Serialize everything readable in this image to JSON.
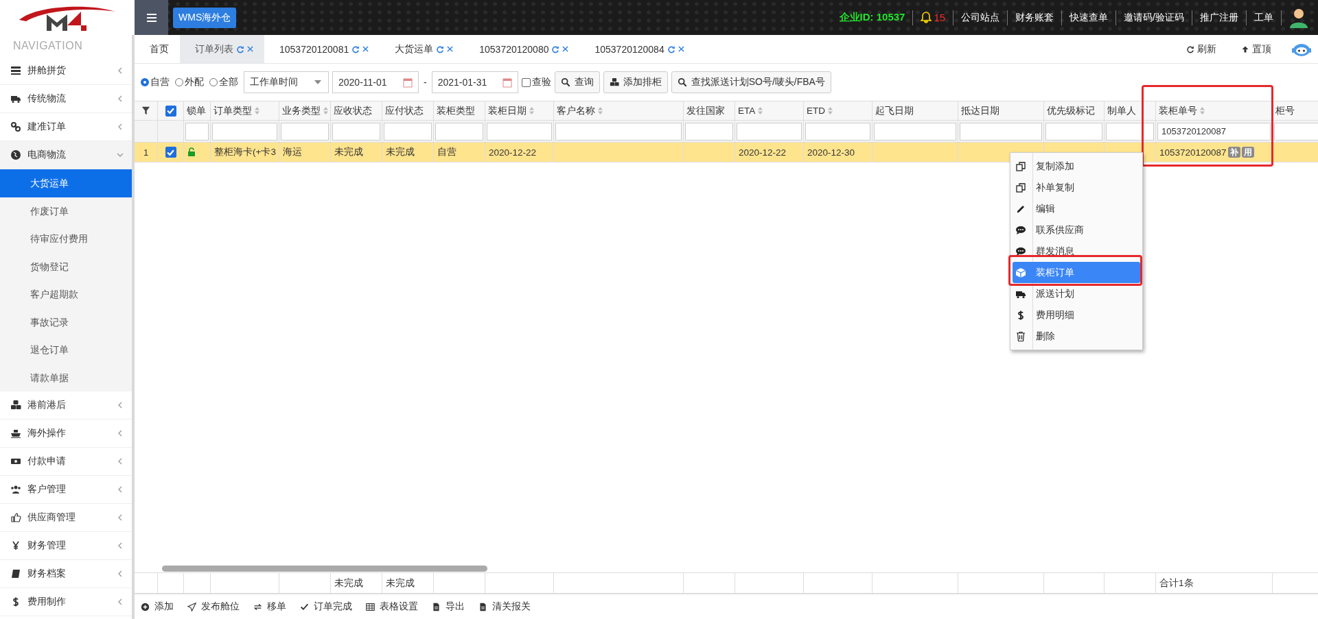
{
  "top_bar": {
    "app_button": "WMS海外仓",
    "company_id": "企业ID: 10537",
    "notifications": "15",
    "links": [
      "公司站点",
      "财务账套",
      "快速查单",
      "邀请码/验证码",
      "推广注册",
      "工单"
    ]
  },
  "sidebar": {
    "title": "NAVIGATION",
    "items": [
      {
        "label": "拼舱拼货",
        "expanded": false
      },
      {
        "label": "传统物流",
        "expanded": false
      },
      {
        "label": "建准订单",
        "expanded": false
      },
      {
        "label": "电商物流",
        "expanded": true,
        "children": [
          {
            "label": "大货运单",
            "selected": true
          },
          {
            "label": "作废订单",
            "selected": false
          },
          {
            "label": "待审应付费用",
            "selected": false
          },
          {
            "label": "货物登记",
            "selected": false
          },
          {
            "label": "客户超期款",
            "selected": false
          },
          {
            "label": "事故记录",
            "selected": false
          },
          {
            "label": "退仓订单",
            "selected": false
          },
          {
            "label": "请款单据",
            "selected": false
          }
        ]
      },
      {
        "label": "港前港后",
        "expanded": false
      },
      {
        "label": "海外操作",
        "expanded": false
      },
      {
        "label": "付款申请",
        "expanded": false
      },
      {
        "label": "客户管理",
        "expanded": false
      },
      {
        "label": "供应商管理",
        "expanded": false
      },
      {
        "label": "财务管理",
        "expanded": false
      },
      {
        "label": "财务档案",
        "expanded": false
      },
      {
        "label": "费用制作",
        "expanded": false
      }
    ]
  },
  "tabs": [
    {
      "label": "首页",
      "selected": false,
      "closable": false
    },
    {
      "label": "订单列表",
      "selected": true,
      "closable": true
    },
    {
      "label": "1053720120081",
      "selected": false,
      "closable": true
    },
    {
      "label": "大货运单",
      "selected": false,
      "closable": true
    },
    {
      "label": "1053720120080",
      "selected": false,
      "closable": true
    },
    {
      "label": "1053720120084",
      "selected": false,
      "closable": true
    }
  ],
  "tab_actions": [
    "刷新",
    "置顶"
  ],
  "filters": {
    "radios": [
      {
        "label": "自营",
        "selected": true
      },
      {
        "label": "外配",
        "selected": false
      },
      {
        "label": "全部",
        "selected": false
      }
    ],
    "date_type": "工作单时间",
    "date_from": "2020-11-01",
    "separator": "-",
    "date_to": "2021-01-31",
    "inspection": {
      "label": "查验",
      "checked": false
    },
    "buttons": [
      "查询",
      "添加排柜",
      "查找派送计划SO号/唛头/FBA号"
    ]
  },
  "table": {
    "all_checked": true,
    "columns": [
      {
        "label": "锁单",
        "sortable": false
      },
      {
        "label": "订单类型",
        "sortable": true
      },
      {
        "label": "业务类型",
        "sortable": true
      },
      {
        "label": "应收状态",
        "sortable": false,
        "footer": "未完成"
      },
      {
        "label": "应付状态",
        "sortable": false,
        "footer": "未完成"
      },
      {
        "label": "装柜类型",
        "sortable": false
      },
      {
        "label": "装柜日期",
        "sortable": true
      },
      {
        "label": "客户名称",
        "sortable": true
      },
      {
        "label": "发往国家",
        "sortable": false
      },
      {
        "label": "ETA",
        "sortable": true
      },
      {
        "label": "ETD",
        "sortable": true
      },
      {
        "label": "起飞日期",
        "sortable": false
      },
      {
        "label": "抵达日期",
        "sortable": false
      },
      {
        "label": "优先级标记",
        "sortable": false
      },
      {
        "label": "制单人",
        "sortable": false
      },
      {
        "label": "装柜单号",
        "sortable": true,
        "filter": "1053720120087",
        "footer": "合计1条"
      },
      {
        "label": "柜号",
        "sortable": false
      }
    ],
    "rows": [
      {
        "number": "1",
        "checked": true,
        "selected": true,
        "locked": false,
        "cells": [
          null,
          "整柜海卡(+卡3",
          "海运",
          "未完成",
          "未完成",
          "自营",
          "2020-12-22",
          null,
          null,
          "2020-12-22",
          "2020-12-30",
          null,
          null,
          null,
          null,
          {
            "text": "1053720120087",
            "badges": [
              "补",
              "用"
            ]
          },
          null
        ]
      }
    ]
  },
  "context_menu": [
    {
      "label": "复制添加",
      "selected": false
    },
    {
      "label": "补单复制",
      "selected": false
    },
    {
      "label": "编辑",
      "selected": false
    },
    {
      "label": "联系供应商",
      "selected": false
    },
    {
      "label": "群发消息",
      "selected": false
    },
    {
      "label": "装柜订单",
      "selected": true
    },
    {
      "label": "派送计划",
      "selected": false
    },
    {
      "label": "费用明细",
      "selected": false
    },
    {
      "label": "删除",
      "selected": false
    }
  ],
  "bottom_toolbar": [
    "添加",
    "发布舱位",
    "移单",
    "订单完成",
    "表格设置",
    "导出",
    "清关报关"
  ]
}
